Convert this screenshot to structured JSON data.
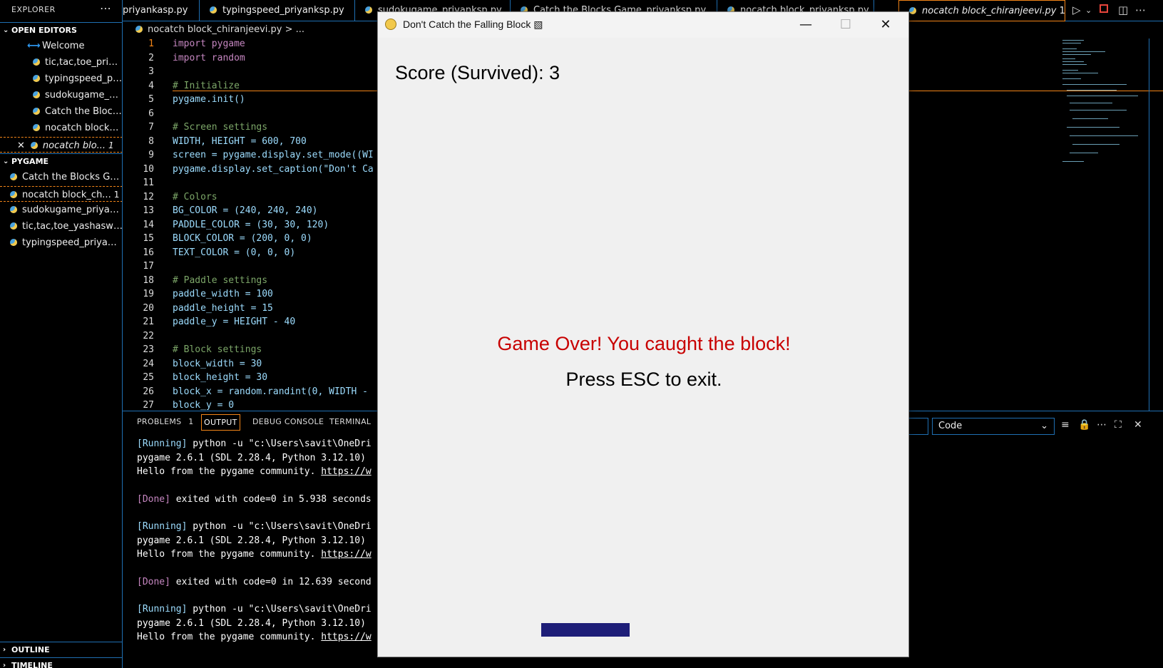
{
  "sidebar": {
    "title": "EXPLORER",
    "menu_icon": "more-icon",
    "open_editors": {
      "header": "OPEN EDITORS",
      "items": [
        {
          "label": "Welcome",
          "icon": "vscode-icon"
        },
        {
          "label": "tic,tac,toe_priya...",
          "icon": "python-file-icon"
        },
        {
          "label": "typingspeed_pri...",
          "icon": "python-file-icon"
        },
        {
          "label": "sudokugame_pri...",
          "icon": "python-file-icon"
        },
        {
          "label": "Catch the Blocks...",
          "icon": "python-file-icon"
        },
        {
          "label": "nocatch block_p...",
          "icon": "python-file-icon"
        },
        {
          "label": "nocatch blo...",
          "icon": "python-file-icon",
          "badge": "1"
        }
      ]
    },
    "folder": {
      "header": "PYGAME",
      "items": [
        {
          "label": "Catch the Blocks Gam...",
          "icon": "python-file-icon"
        },
        {
          "label": "nocatch block_ch...",
          "icon": "python-file-icon",
          "badge": "1"
        },
        {
          "label": "sudokugame_priyank...",
          "icon": "python-file-icon"
        },
        {
          "label": "tic,tac,toe_yashaswini....",
          "icon": "python-file-icon"
        },
        {
          "label": "typingspeed_priyanks...",
          "icon": "python-file-icon"
        }
      ]
    },
    "outline": "OUTLINE",
    "timeline": "TIMELINE"
  },
  "tabs": [
    {
      "label": "priyankasp.py"
    },
    {
      "label": "typingspeed_priyanksp.py"
    },
    {
      "label": "sudokugame_priyanksp.py"
    },
    {
      "label": "Catch the Blocks Game_priyanksp.py"
    },
    {
      "label": "nocatch block_priyanksp.py"
    },
    {
      "label": "nocatch block_chiranjeevi.py",
      "badge": "1",
      "active": true
    }
  ],
  "breadcrumb": "nocatch block_chiranjeevi.py > ...",
  "editor": {
    "line_numbers": [
      "1",
      "2",
      "3",
      "4",
      "5",
      "6",
      "7",
      "8",
      "9",
      "10",
      "11",
      "12",
      "13",
      "14",
      "15",
      "16",
      "17",
      "18",
      "19",
      "20",
      "21",
      "22",
      "23",
      "24",
      "25",
      "26",
      "27"
    ],
    "lines": [
      "import pygame",
      "import random",
      "",
      "# Initialize",
      "pygame.init()",
      "",
      "# Screen settings",
      "WIDTH, HEIGHT = 600, 700",
      "screen = pygame.display.set_mode((WI",
      "pygame.display.set_caption(\"Don't Ca",
      "",
      "# Colors",
      "BG_COLOR = (240, 240, 240)",
      "PADDLE_COLOR = (30, 30, 120)",
      "BLOCK_COLOR = (200, 0, 0)",
      "TEXT_COLOR = (0, 0, 0)",
      "",
      "# Paddle settings",
      "paddle_width = 100",
      "paddle_height = 15",
      "paddle_y = HEIGHT - 40",
      "",
      "# Block settings",
      "block_width = 30",
      "block_height = 30",
      "block_x = random.randint(0, WIDTH -",
      "block_y = 0"
    ]
  },
  "panel": {
    "tabs": [
      {
        "label": "PROBLEMS",
        "badge": "1"
      },
      {
        "label": "OUTPUT",
        "active": true
      },
      {
        "label": "DEBUG CONSOLE"
      },
      {
        "label": "TERMINAL"
      }
    ],
    "output_select": "Code",
    "output": [
      {
        "tag": "[Running]",
        "text": " python -u \"c:\\Users\\savit\\OneDri"
      },
      {
        "text": "pygame 2.6.1 (SDL 2.28.4, Python 3.12.10)"
      },
      {
        "text": "Hello from the pygame community. ",
        "link": "https://w"
      },
      {
        "text": ""
      },
      {
        "done": "[Done]",
        "text": " exited with code=0 in 5.938 seconds"
      },
      {
        "text": ""
      },
      {
        "tag": "[Running]",
        "text": " python -u \"c:\\Users\\savit\\OneDri"
      },
      {
        "text": "pygame 2.6.1 (SDL 2.28.4, Python 3.12.10)"
      },
      {
        "text": "Hello from the pygame community. ",
        "link": "https://w"
      },
      {
        "text": ""
      },
      {
        "done": "[Done]",
        "text": " exited with code=0 in 12.639 second"
      },
      {
        "text": ""
      },
      {
        "tag": "[Running]",
        "text": " python -u \"c:\\Users\\savit\\OneDri"
      },
      {
        "text": "pygame 2.6.1 (SDL 2.28.4, Python 3.12.10)"
      },
      {
        "text": "Hello from the pygame community. ",
        "link": "https://w"
      }
    ]
  },
  "game_window": {
    "title": "Don't Catch the Falling Block ▧",
    "score_text": "Score (Survived): 3",
    "game_over_text": "Game Over! You caught the block!",
    "exit_text": "Press ESC to exit.",
    "bg_color": "#f0f0f0",
    "paddle_color": "#1e1e78",
    "message_color": "#c80000"
  },
  "colors": {
    "accent": "#1f6fb2",
    "active_border": "#f38518"
  }
}
